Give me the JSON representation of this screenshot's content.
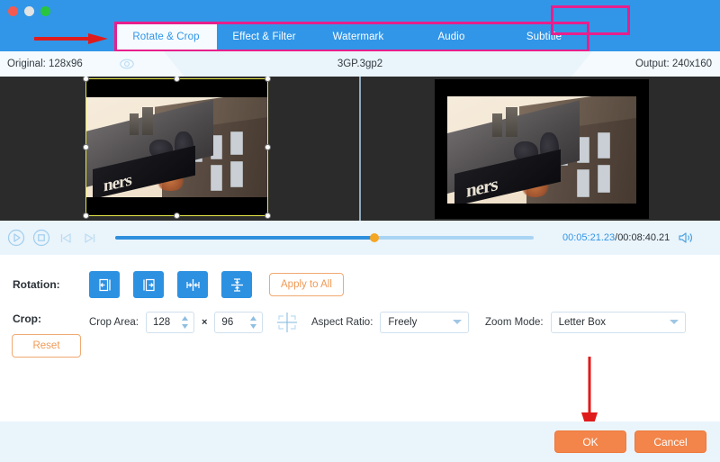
{
  "window": {
    "traffic_lights": [
      "close",
      "minimize",
      "maximize"
    ]
  },
  "tabs": [
    {
      "label": "Rotate & Crop",
      "active": true,
      "width": 113
    },
    {
      "label": "Effect & Filter",
      "active": false,
      "width": 105
    },
    {
      "label": "Watermark",
      "active": false,
      "width": 104
    },
    {
      "label": "Audio",
      "active": false,
      "width": 103
    },
    {
      "label": "Subtitle",
      "active": false,
      "width": 103
    }
  ],
  "highlight_color": "#e81f8c",
  "arrow_color": "#e01b1b",
  "info_bar": {
    "original_label": "Original: 128x96",
    "file_label": "3GP.3gp2",
    "output_label": "Output: 240x160",
    "eye_icon": "eye-icon"
  },
  "preview": {
    "sign_text": "ners",
    "crop_handles": 8,
    "crop_border_color": "#e8e84a"
  },
  "playback": {
    "play_icon": "play-icon",
    "stop_icon": "stop-icon",
    "prev_icon": "previous-frame-icon",
    "next_icon": "next-frame-icon",
    "current_time": "00:05:21.23",
    "separator": "/",
    "total_time": "00:08:40.21",
    "volume_icon": "volume-icon",
    "progress_percent": 62
  },
  "rotation": {
    "label": "Rotation:",
    "buttons": [
      {
        "name": "rotate-left-button"
      },
      {
        "name": "rotate-right-button"
      },
      {
        "name": "flip-horizontal-button"
      },
      {
        "name": "flip-vertical-button"
      }
    ],
    "apply_to_all_label": "Apply to All"
  },
  "crop": {
    "label": "Crop:",
    "reset_label": "Reset",
    "crop_area_label": "Crop Area:",
    "width_value": "128",
    "multiply_symbol": "×",
    "height_value": "96",
    "grid_icon": "crop-grid-icon",
    "aspect_ratio_label": "Aspect Ratio:",
    "aspect_ratio_value": "Freely",
    "zoom_mode_label": "Zoom Mode:",
    "zoom_mode_value": "Letter Box"
  },
  "footer": {
    "ok_label": "OK",
    "cancel_label": "Cancel"
  }
}
